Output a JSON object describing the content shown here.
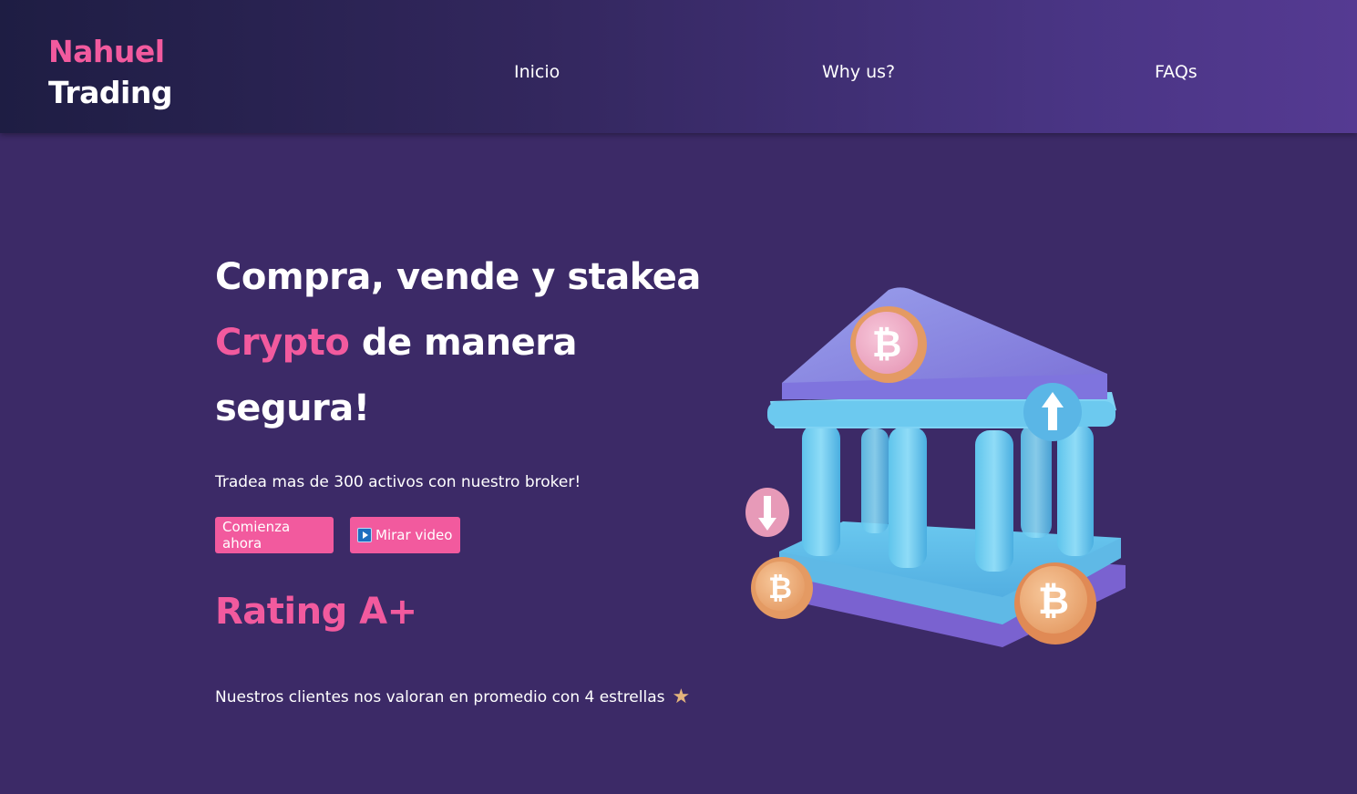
{
  "brand": {
    "line1": "Nahuel",
    "line2": "Trading",
    "accent_color": "#f25a9e"
  },
  "nav": {
    "items": [
      "Inicio",
      "Why us?",
      "FAQs"
    ]
  },
  "hero": {
    "title_part1": "Compra, vende y stakea",
    "title_highlight": "Crypto",
    "title_part2": " de manera",
    "title_part3": "segura!",
    "tagline": "Tradea mas de 300 activos con nuestro broker!",
    "primary_button": "Comienza ahora",
    "video_button": "Mirar video",
    "video_icon": "play-icon",
    "illustration": "bank-bitcoin-illustration"
  },
  "rating": {
    "title": "Rating A+",
    "text": "Nuestros clientes nos valoran en promedio con 4 estrellas",
    "icon": "star-icon",
    "stars": 4
  },
  "colors": {
    "background": "#3c2a67",
    "pink": "#f25a9e",
    "nav_start": "#1e1d43",
    "nav_end": "#553a92"
  }
}
